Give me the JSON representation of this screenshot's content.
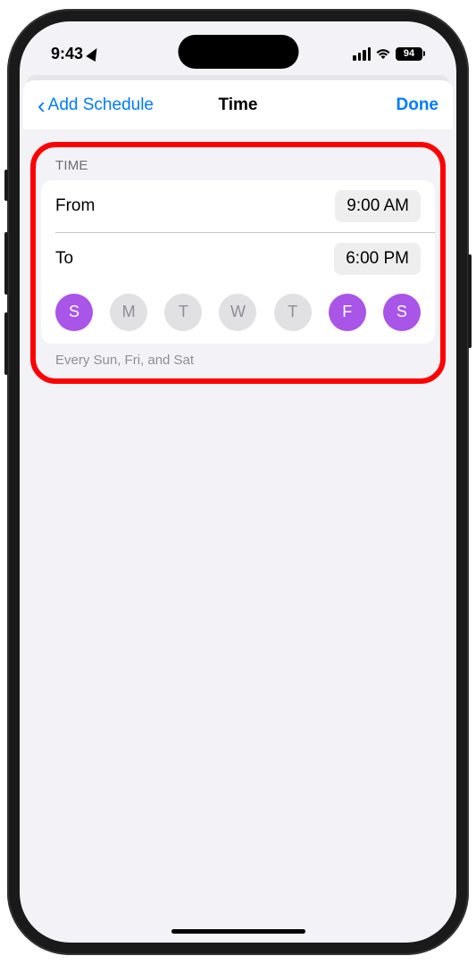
{
  "status_bar": {
    "time": "9:43",
    "battery": "94"
  },
  "nav": {
    "back_label": "Add Schedule",
    "title": "Time",
    "done_label": "Done"
  },
  "section": {
    "header": "TIME",
    "from_label": "From",
    "from_value": "9:00 AM",
    "to_label": "To",
    "to_value": "6:00 PM",
    "days": [
      {
        "letter": "S",
        "selected": true
      },
      {
        "letter": "M",
        "selected": false
      },
      {
        "letter": "T",
        "selected": false
      },
      {
        "letter": "W",
        "selected": false
      },
      {
        "letter": "T",
        "selected": false
      },
      {
        "letter": "F",
        "selected": true
      },
      {
        "letter": "S",
        "selected": true
      }
    ],
    "footer": "Every Sun, Fri, and Sat"
  }
}
